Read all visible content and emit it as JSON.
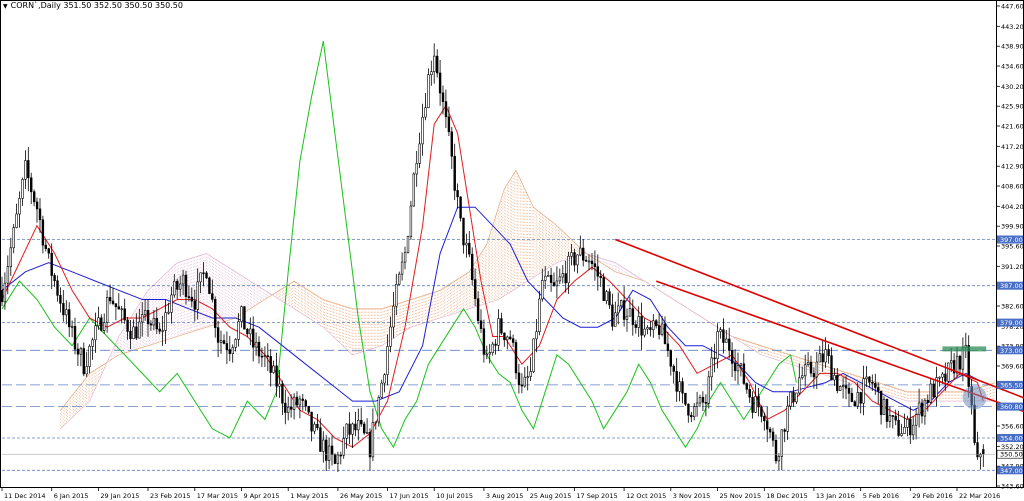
{
  "window": {
    "symbol_line": "CORN`,Daily  351.50 352.50 350.50 350.50"
  },
  "colors": {
    "background": "#ffffff",
    "up_candle": "#ffffff",
    "down_candle": "#000000",
    "tenkan": "#e31a1c",
    "kijun": "#1f1fd6",
    "chikou": "#19c219",
    "cloud_a": "#e8a070",
    "cloud_b": "#e0b0d0",
    "trendline": "#e00000",
    "level_line": "#6080c0",
    "last_price_box": "#1f1fd6",
    "resistance_zone": "#2e8b57",
    "highlight_circle": "#7090c0"
  },
  "chart_data": {
    "type": "candlestick",
    "title": "",
    "instrument": "CORN`",
    "timeframe": "Daily",
    "ohlc_last": {
      "open": 351.5,
      "high": 352.5,
      "low": 350.5,
      "close": 350.5
    },
    "y_axis": {
      "range": [
        343.6,
        447.6
      ],
      "ticks": [
        "447.60",
        "443.20",
        "438.90",
        "434.60",
        "430.20",
        "425.90",
        "421.60",
        "417.20",
        "412.90",
        "408.60",
        "404.20",
        "399.90",
        "395.60",
        "391.20",
        "386.90",
        "382.60",
        "378.20",
        "373.90",
        "369.60",
        "365.20",
        "360.90",
        "356.60",
        "352.20",
        "347.90",
        "343.60"
      ],
      "tick_values": [
        447.6,
        443.2,
        438.9,
        434.6,
        430.2,
        425.9,
        421.6,
        417.2,
        412.9,
        408.6,
        404.2,
        399.9,
        395.6,
        391.2,
        386.9,
        382.6,
        378.2,
        373.9,
        369.6,
        365.2,
        360.9,
        356.6,
        352.2,
        347.9,
        343.6
      ]
    },
    "x_axis": {
      "ticks": [
        "11 Dec 2014",
        "6 Jan 2015",
        "29 Jan 2015",
        "23 Feb 2015",
        "17 Mar 2015",
        "9 Apr 2015",
        "1 May 2015",
        "26 May 2015",
        "17 Jun 2015",
        "10 Jul 2015",
        "3 Aug 2015",
        "25 Aug 2015",
        "17 Sep 2015",
        "12 Oct 2015",
        "3 Nov 2015",
        "25 Nov 2015",
        "18 Dec 2015",
        "13 Jan 2016",
        "5 Feb 2016",
        "29 Feb 2016",
        "22 Mar 2016"
      ],
      "tick_index": [
        0,
        17,
        33,
        50,
        66,
        82,
        98,
        115,
        132,
        148,
        165,
        180,
        196,
        213,
        229,
        245,
        261,
        278,
        294,
        311,
        327
      ]
    },
    "horizontal_levels": [
      {
        "label": "397.00",
        "value": 397.0,
        "style": "dashed-thin"
      },
      {
        "label": "387.00",
        "value": 387.0,
        "style": "dashed-thin"
      },
      {
        "label": "379.00",
        "value": 379.0,
        "style": "dashed-thin"
      },
      {
        "label": "373.00",
        "value": 373.0,
        "style": "dashed-long"
      },
      {
        "label": "365.50",
        "value": 365.5,
        "style": "dashed-long"
      },
      {
        "label": "360.80",
        "value": 360.8,
        "style": "dashed-long"
      },
      {
        "label": "354.00",
        "value": 354.0,
        "style": "dashed-thin"
      },
      {
        "label": "347.00",
        "value": 347.0,
        "style": "dashed-thin"
      }
    ],
    "current_price": {
      "label": "350.50",
      "value": 350.5
    },
    "trendlines": [
      {
        "from": [
          210,
          397.0
        ],
        "to": [
          420,
          345.5
        ]
      },
      {
        "from": [
          224,
          388.0
        ],
        "to": [
          400,
          348.5
        ]
      }
    ],
    "resistance_zone": {
      "from_index": 322,
      "to_index": 337,
      "value": 373.3
    },
    "highlight_circle": {
      "index": 333,
      "value": 362.8
    },
    "price_path": [
      [
        0,
        386
      ],
      [
        4,
        398
      ],
      [
        8,
        412
      ],
      [
        12,
        404
      ],
      [
        16,
        392
      ],
      [
        20,
        384
      ],
      [
        24,
        376
      ],
      [
        28,
        370
      ],
      [
        33,
        378
      ],
      [
        37,
        385
      ],
      [
        41,
        380
      ],
      [
        45,
        377
      ],
      [
        50,
        380
      ],
      [
        54,
        376
      ],
      [
        58,
        385
      ],
      [
        62,
        388
      ],
      [
        66,
        384
      ],
      [
        70,
        391
      ],
      [
        74,
        376
      ],
      [
        78,
        374
      ],
      [
        82,
        380
      ],
      [
        86,
        374
      ],
      [
        90,
        371
      ],
      [
        94,
        366
      ],
      [
        98,
        360
      ],
      [
        102,
        362
      ],
      [
        106,
        356
      ],
      [
        110,
        352
      ],
      [
        114,
        348
      ],
      [
        118,
        355
      ],
      [
        122,
        356
      ],
      [
        126,
        352
      ],
      [
        130,
        366
      ],
      [
        134,
        382
      ],
      [
        138,
        394
      ],
      [
        142,
        416
      ],
      [
        146,
        432
      ],
      [
        148,
        438
      ],
      [
        151,
        426
      ],
      [
        154,
        414
      ],
      [
        157,
        400
      ],
      [
        160,
        392
      ],
      [
        163,
        380
      ],
      [
        166,
        370
      ],
      [
        170,
        378
      ],
      [
        174,
        376
      ],
      [
        178,
        364
      ],
      [
        181,
        368
      ],
      [
        185,
        388
      ],
      [
        189,
        386
      ],
      [
        193,
        390
      ],
      [
        197,
        394
      ],
      [
        201,
        393
      ],
      [
        205,
        388
      ],
      [
        209,
        380
      ],
      [
        213,
        382
      ],
      [
        217,
        380
      ],
      [
        221,
        376
      ],
      [
        225,
        378
      ],
      [
        229,
        371
      ],
      [
        233,
        362
      ],
      [
        237,
        360
      ],
      [
        241,
        362
      ],
      [
        245,
        376
      ],
      [
        249,
        374
      ],
      [
        253,
        368
      ],
      [
        257,
        362
      ],
      [
        261,
        360
      ],
      [
        265,
        350
      ],
      [
        269,
        360
      ],
      [
        273,
        367
      ],
      [
        278,
        369
      ],
      [
        282,
        372
      ],
      [
        286,
        366
      ],
      [
        290,
        362
      ],
      [
        294,
        364
      ],
      [
        298,
        366
      ],
      [
        302,
        360
      ],
      [
        306,
        356
      ],
      [
        310,
        356
      ],
      [
        314,
        360
      ],
      [
        318,
        364
      ],
      [
        322,
        366
      ],
      [
        326,
        370
      ],
      [
        330,
        372
      ],
      [
        332,
        360
      ],
      [
        333,
        352
      ],
      [
        334,
        348
      ],
      [
        335,
        351
      ],
      [
        336,
        350.5
      ]
    ],
    "tenkan_path": [
      [
        0,
        384
      ],
      [
        6,
        392
      ],
      [
        12,
        400
      ],
      [
        18,
        394
      ],
      [
        24,
        386
      ],
      [
        30,
        380
      ],
      [
        36,
        378
      ],
      [
        42,
        380
      ],
      [
        48,
        380
      ],
      [
        54,
        382
      ],
      [
        60,
        384
      ],
      [
        66,
        384
      ],
      [
        72,
        382
      ],
      [
        78,
        378
      ],
      [
        84,
        376
      ],
      [
        90,
        372
      ],
      [
        96,
        366
      ],
      [
        102,
        360
      ],
      [
        108,
        358
      ],
      [
        114,
        354
      ],
      [
        120,
        352
      ],
      [
        126,
        355
      ],
      [
        132,
        362
      ],
      [
        138,
        378
      ],
      [
        144,
        400
      ],
      [
        148,
        422
      ],
      [
        152,
        426
      ],
      [
        156,
        420
      ],
      [
        160,
        404
      ],
      [
        164,
        388
      ],
      [
        168,
        376
      ],
      [
        172,
        376
      ],
      [
        178,
        370
      ],
      [
        184,
        374
      ],
      [
        190,
        384
      ],
      [
        196,
        388
      ],
      [
        202,
        391
      ],
      [
        208,
        388
      ],
      [
        214,
        384
      ],
      [
        220,
        380
      ],
      [
        226,
        378
      ],
      [
        232,
        374
      ],
      [
        238,
        368
      ],
      [
        244,
        370
      ],
      [
        250,
        372
      ],
      [
        256,
        366
      ],
      [
        262,
        358
      ],
      [
        268,
        360
      ],
      [
        274,
        364
      ],
      [
        280,
        368
      ],
      [
        286,
        368
      ],
      [
        292,
        366
      ],
      [
        298,
        362
      ],
      [
        304,
        360
      ],
      [
        310,
        358
      ],
      [
        316,
        360
      ],
      [
        322,
        364
      ],
      [
        328,
        368
      ],
      [
        334,
        366
      ],
      [
        336,
        362
      ]
    ],
    "kijun_path": [
      [
        0,
        386
      ],
      [
        8,
        390
      ],
      [
        16,
        392
      ],
      [
        24,
        390
      ],
      [
        32,
        388
      ],
      [
        40,
        386
      ],
      [
        48,
        384
      ],
      [
        56,
        384
      ],
      [
        64,
        382
      ],
      [
        72,
        380
      ],
      [
        80,
        380
      ],
      [
        88,
        378
      ],
      [
        96,
        374
      ],
      [
        104,
        370
      ],
      [
        112,
        366
      ],
      [
        120,
        362
      ],
      [
        128,
        362
      ],
      [
        136,
        364
      ],
      [
        144,
        374
      ],
      [
        150,
        394
      ],
      [
        156,
        404
      ],
      [
        162,
        404
      ],
      [
        168,
        400
      ],
      [
        174,
        396
      ],
      [
        180,
        388
      ],
      [
        186,
        384
      ],
      [
        192,
        380
      ],
      [
        198,
        378
      ],
      [
        204,
        378
      ],
      [
        210,
        380
      ],
      [
        216,
        386
      ],
      [
        222,
        384
      ],
      [
        228,
        378
      ],
      [
        234,
        374
      ],
      [
        240,
        374
      ],
      [
        246,
        372
      ],
      [
        252,
        370
      ],
      [
        258,
        366
      ],
      [
        264,
        364
      ],
      [
        270,
        364
      ],
      [
        276,
        365
      ],
      [
        282,
        366
      ],
      [
        288,
        368
      ],
      [
        294,
        366
      ],
      [
        300,
        364
      ],
      [
        306,
        362
      ],
      [
        312,
        360
      ],
      [
        318,
        362
      ],
      [
        324,
        366
      ],
      [
        330,
        368
      ],
      [
        336,
        366
      ]
    ],
    "chikou_path": [
      [
        0,
        382
      ],
      [
        6,
        388
      ],
      [
        12,
        384
      ],
      [
        18,
        378
      ],
      [
        24,
        374
      ],
      [
        30,
        380
      ],
      [
        36,
        376
      ],
      [
        42,
        372
      ],
      [
        48,
        368
      ],
      [
        54,
        364
      ],
      [
        60,
        368
      ],
      [
        66,
        362
      ],
      [
        72,
        356
      ],
      [
        78,
        354
      ],
      [
        84,
        362
      ],
      [
        90,
        358
      ],
      [
        94,
        364
      ],
      [
        98,
        390
      ],
      [
        102,
        414
      ],
      [
        106,
        428
      ],
      [
        110,
        440
      ],
      [
        114,
        420
      ],
      [
        118,
        400
      ],
      [
        122,
        380
      ],
      [
        126,
        364
      ],
      [
        130,
        356
      ],
      [
        134,
        352
      ],
      [
        138,
        358
      ],
      [
        142,
        362
      ],
      [
        146,
        370
      ],
      [
        150,
        374
      ],
      [
        154,
        378
      ],
      [
        158,
        382
      ],
      [
        162,
        378
      ],
      [
        166,
        372
      ],
      [
        170,
        368
      ],
      [
        174,
        366
      ],
      [
        178,
        360
      ],
      [
        182,
        356
      ],
      [
        186,
        364
      ],
      [
        190,
        372
      ],
      [
        194,
        370
      ],
      [
        198,
        366
      ],
      [
        202,
        362
      ],
      [
        206,
        356
      ],
      [
        210,
        360
      ],
      [
        214,
        364
      ],
      [
        218,
        370
      ],
      [
        222,
        366
      ],
      [
        226,
        360
      ],
      [
        230,
        356
      ],
      [
        234,
        352
      ],
      [
        238,
        356
      ],
      [
        242,
        362
      ],
      [
        246,
        366
      ],
      [
        250,
        362
      ],
      [
        254,
        358
      ],
      [
        258,
        362
      ],
      [
        262,
        366
      ],
      [
        266,
        370
      ],
      [
        270,
        372
      ],
      [
        272,
        366
      ]
    ],
    "cloud": {
      "senkou_a": [
        [
          20,
          360
        ],
        [
          30,
          368
        ],
        [
          40,
          372
        ],
        [
          50,
          374
        ],
        [
          60,
          376
        ],
        [
          70,
          378
        ],
        [
          80,
          380
        ],
        [
          90,
          384
        ],
        [
          100,
          388
        ],
        [
          110,
          384
        ],
        [
          120,
          382
        ],
        [
          130,
          382
        ],
        [
          140,
          384
        ],
        [
          150,
          386
        ],
        [
          160,
          390
        ],
        [
          166,
          396
        ],
        [
          172,
          408
        ],
        [
          176,
          412
        ],
        [
          182,
          404
        ],
        [
          190,
          400
        ],
        [
          200,
          394
        ],
        [
          210,
          390
        ],
        [
          220,
          388
        ],
        [
          230,
          384
        ],
        [
          240,
          380
        ],
        [
          250,
          376
        ],
        [
          260,
          374
        ],
        [
          270,
          372
        ],
        [
          280,
          370
        ],
        [
          290,
          368
        ],
        [
          300,
          366
        ],
        [
          310,
          364
        ],
        [
          320,
          364
        ],
        [
          330,
          364
        ],
        [
          340,
          366
        ]
      ],
      "senkou_b": [
        [
          20,
          356
        ],
        [
          30,
          362
        ],
        [
          40,
          376
        ],
        [
          50,
          386
        ],
        [
          60,
          392
        ],
        [
          70,
          394
        ],
        [
          80,
          390
        ],
        [
          90,
          386
        ],
        [
          100,
          382
        ],
        [
          110,
          378
        ],
        [
          120,
          372
        ],
        [
          130,
          374
        ],
        [
          140,
          378
        ],
        [
          150,
          380
        ],
        [
          160,
          382
        ],
        [
          170,
          384
        ],
        [
          180,
          388
        ],
        [
          190,
          392
        ],
        [
          200,
          394
        ],
        [
          210,
          392
        ],
        [
          220,
          388
        ],
        [
          230,
          384
        ],
        [
          240,
          380
        ],
        [
          250,
          376
        ],
        [
          260,
          372
        ],
        [
          270,
          370
        ],
        [
          280,
          368
        ],
        [
          290,
          366
        ],
        [
          300,
          364
        ],
        [
          310,
          362
        ],
        [
          320,
          362
        ],
        [
          330,
          362
        ],
        [
          340,
          362
        ]
      ]
    }
  }
}
